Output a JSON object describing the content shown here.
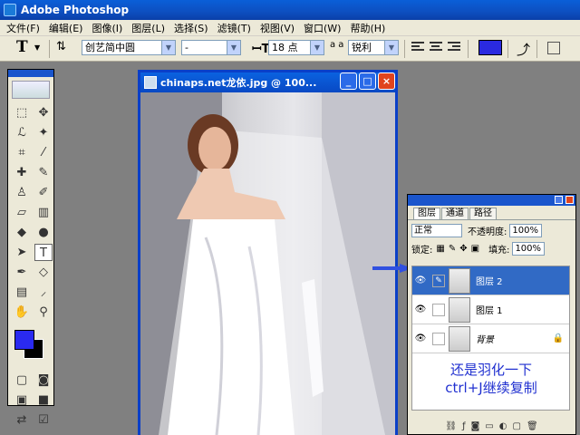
{
  "app": {
    "title": "Adobe Photoshop"
  },
  "menu": [
    "文件(F)",
    "编辑(E)",
    "图像(I)",
    "图层(L)",
    "选择(S)",
    "滤镜(T)",
    "视图(V)",
    "窗口(W)",
    "帮助(H)"
  ],
  "options": {
    "tool_glyph": "T",
    "font_family": "创艺简中圆",
    "font_style": "-",
    "font_size": "18 点",
    "aa_label": "a a",
    "anti_alias": "锐利",
    "text_color": "#2a2ae0"
  },
  "document": {
    "title": "chinaps.net龙依.jpg @ 100...",
    "minimize": "_",
    "maximize": "□",
    "close": "×"
  },
  "layers_palette": {
    "tabs": [
      "图层",
      "通道",
      "路径"
    ],
    "blend_mode": "正常",
    "opacity_label": "不透明度:",
    "opacity": "100%",
    "lock_label": "锁定:",
    "fill_label": "填充:",
    "fill": "100%",
    "layers": [
      {
        "name": "图层 2",
        "active": true
      },
      {
        "name": "图层 1",
        "active": false
      },
      {
        "name": "背景",
        "active": false
      }
    ],
    "note_line1": "还是羽化一下",
    "note_line2": "ctrl+J继续复制"
  },
  "toolbox": {
    "fg_color": "#2a2af0",
    "bg_color": "#000000"
  }
}
